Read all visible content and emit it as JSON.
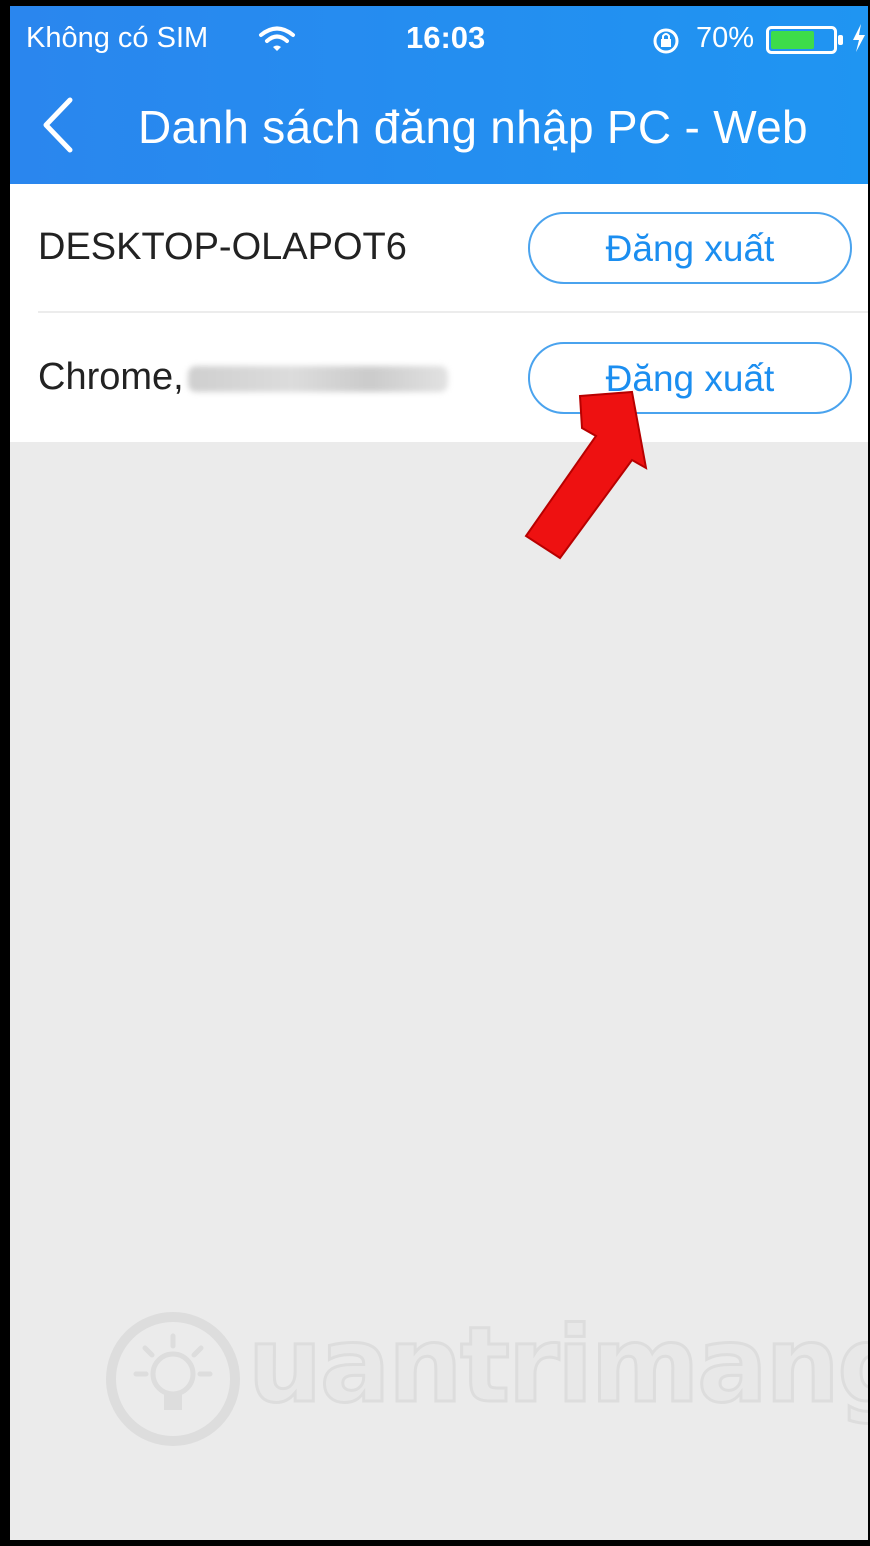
{
  "status_bar": {
    "carrier": "Không có SIM",
    "time": "16:03",
    "battery_percent": "70%",
    "battery_level": 0.7,
    "icons": [
      "wifi-icon",
      "orientation-lock-icon",
      "battery-icon",
      "charging-icon"
    ]
  },
  "nav": {
    "back_icon": "chevron-left-icon",
    "title": "Danh sách đăng nhập PC - Web"
  },
  "sessions": [
    {
      "device": "DESKTOP-OLAPOT6",
      "action": "Đăng xuất"
    },
    {
      "device": "Chrome,",
      "version_redacted": true,
      "action": "Đăng xuất"
    }
  ],
  "annotation": {
    "type": "red-arrow",
    "points_to": "sessions.1.action",
    "color": "#ee1111"
  },
  "watermark": {
    "text": "uantrimang",
    "logo": "lightbulb-icon"
  },
  "colors": {
    "header_start": "#2a86ee",
    "header_end": "#1f95f2",
    "button_text": "#1b8ef0",
    "button_border": "#4aa3ee",
    "background": "#ebebeb",
    "battery_fill": "#3ddc4a"
  }
}
